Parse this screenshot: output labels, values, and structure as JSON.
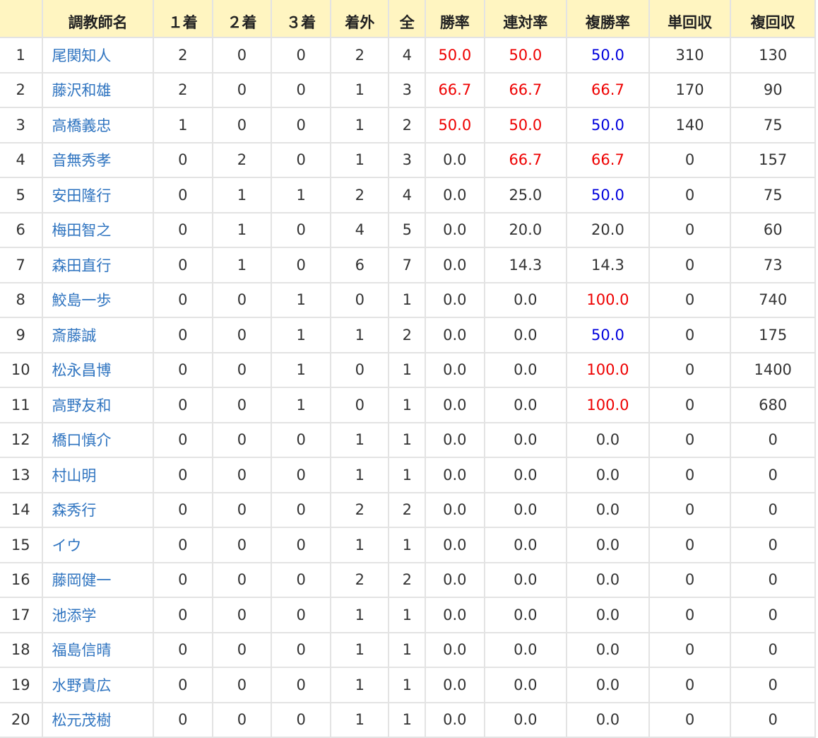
{
  "colors": {
    "header_bg": "#fff5c1",
    "link": "#2f74c0",
    "high": "#ee0000",
    "mid": "#0000dd",
    "text": "#333333",
    "border": "#e3e3e3"
  },
  "headers": [
    "",
    "調教師名",
    "１着",
    "２着",
    "３着",
    "着外",
    "全",
    "勝率",
    "連対率",
    "複勝率",
    "単回収",
    "複回収"
  ],
  "rows": [
    {
      "rank": "1",
      "name": "尾関知人",
      "first": "2",
      "second": "0",
      "third": "0",
      "out": "2",
      "total": "4",
      "win_rate": "50.0",
      "win_color": "red",
      "quinella_rate": "50.0",
      "quinella_color": "red",
      "place_rate": "50.0",
      "place_color": "blue",
      "win_return": "310",
      "place_return": "130"
    },
    {
      "rank": "2",
      "name": "藤沢和雄",
      "first": "2",
      "second": "0",
      "third": "0",
      "out": "1",
      "total": "3",
      "win_rate": "66.7",
      "win_color": "red",
      "quinella_rate": "66.7",
      "quinella_color": "red",
      "place_rate": "66.7",
      "place_color": "red",
      "win_return": "170",
      "place_return": "90"
    },
    {
      "rank": "3",
      "name": "高橋義忠",
      "first": "1",
      "second": "0",
      "third": "0",
      "out": "1",
      "total": "2",
      "win_rate": "50.0",
      "win_color": "red",
      "quinella_rate": "50.0",
      "quinella_color": "red",
      "place_rate": "50.0",
      "place_color": "blue",
      "win_return": "140",
      "place_return": "75"
    },
    {
      "rank": "4",
      "name": "音無秀孝",
      "first": "0",
      "second": "2",
      "third": "0",
      "out": "1",
      "total": "3",
      "win_rate": "0.0",
      "win_color": "",
      "quinella_rate": "66.7",
      "quinella_color": "red",
      "place_rate": "66.7",
      "place_color": "red",
      "win_return": "0",
      "place_return": "157"
    },
    {
      "rank": "5",
      "name": "安田隆行",
      "first": "0",
      "second": "1",
      "third": "1",
      "out": "2",
      "total": "4",
      "win_rate": "0.0",
      "win_color": "",
      "quinella_rate": "25.0",
      "quinella_color": "",
      "place_rate": "50.0",
      "place_color": "blue",
      "win_return": "0",
      "place_return": "75"
    },
    {
      "rank": "6",
      "name": "梅田智之",
      "first": "0",
      "second": "1",
      "third": "0",
      "out": "4",
      "total": "5",
      "win_rate": "0.0",
      "win_color": "",
      "quinella_rate": "20.0",
      "quinella_color": "",
      "place_rate": "20.0",
      "place_color": "",
      "win_return": "0",
      "place_return": "60"
    },
    {
      "rank": "7",
      "name": "森田直行",
      "first": "0",
      "second": "1",
      "third": "0",
      "out": "6",
      "total": "7",
      "win_rate": "0.0",
      "win_color": "",
      "quinella_rate": "14.3",
      "quinella_color": "",
      "place_rate": "14.3",
      "place_color": "",
      "win_return": "0",
      "place_return": "73"
    },
    {
      "rank": "8",
      "name": "鮫島一歩",
      "first": "0",
      "second": "0",
      "third": "1",
      "out": "0",
      "total": "1",
      "win_rate": "0.0",
      "win_color": "",
      "quinella_rate": "0.0",
      "quinella_color": "",
      "place_rate": "100.0",
      "place_color": "red",
      "win_return": "0",
      "place_return": "740"
    },
    {
      "rank": "9",
      "name": "斎藤誠",
      "first": "0",
      "second": "0",
      "third": "1",
      "out": "1",
      "total": "2",
      "win_rate": "0.0",
      "win_color": "",
      "quinella_rate": "0.0",
      "quinella_color": "",
      "place_rate": "50.0",
      "place_color": "blue",
      "win_return": "0",
      "place_return": "175"
    },
    {
      "rank": "10",
      "name": "松永昌博",
      "first": "0",
      "second": "0",
      "third": "1",
      "out": "0",
      "total": "1",
      "win_rate": "0.0",
      "win_color": "",
      "quinella_rate": "0.0",
      "quinella_color": "",
      "place_rate": "100.0",
      "place_color": "red",
      "win_return": "0",
      "place_return": "1400"
    },
    {
      "rank": "11",
      "name": "高野友和",
      "first": "0",
      "second": "0",
      "third": "1",
      "out": "0",
      "total": "1",
      "win_rate": "0.0",
      "win_color": "",
      "quinella_rate": "0.0",
      "quinella_color": "",
      "place_rate": "100.0",
      "place_color": "red",
      "win_return": "0",
      "place_return": "680"
    },
    {
      "rank": "12",
      "name": "橋口慎介",
      "first": "0",
      "second": "0",
      "third": "0",
      "out": "1",
      "total": "1",
      "win_rate": "0.0",
      "win_color": "",
      "quinella_rate": "0.0",
      "quinella_color": "",
      "place_rate": "0.0",
      "place_color": "",
      "win_return": "0",
      "place_return": "0"
    },
    {
      "rank": "13",
      "name": "村山明",
      "first": "0",
      "second": "0",
      "third": "0",
      "out": "1",
      "total": "1",
      "win_rate": "0.0",
      "win_color": "",
      "quinella_rate": "0.0",
      "quinella_color": "",
      "place_rate": "0.0",
      "place_color": "",
      "win_return": "0",
      "place_return": "0"
    },
    {
      "rank": "14",
      "name": "森秀行",
      "first": "0",
      "second": "0",
      "third": "0",
      "out": "2",
      "total": "2",
      "win_rate": "0.0",
      "win_color": "",
      "quinella_rate": "0.0",
      "quinella_color": "",
      "place_rate": "0.0",
      "place_color": "",
      "win_return": "0",
      "place_return": "0"
    },
    {
      "rank": "15",
      "name": "イウ",
      "first": "0",
      "second": "0",
      "third": "0",
      "out": "1",
      "total": "1",
      "win_rate": "0.0",
      "win_color": "",
      "quinella_rate": "0.0",
      "quinella_color": "",
      "place_rate": "0.0",
      "place_color": "",
      "win_return": "0",
      "place_return": "0"
    },
    {
      "rank": "16",
      "name": "藤岡健一",
      "first": "0",
      "second": "0",
      "third": "0",
      "out": "2",
      "total": "2",
      "win_rate": "0.0",
      "win_color": "",
      "quinella_rate": "0.0",
      "quinella_color": "",
      "place_rate": "0.0",
      "place_color": "",
      "win_return": "0",
      "place_return": "0"
    },
    {
      "rank": "17",
      "name": "池添学",
      "first": "0",
      "second": "0",
      "third": "0",
      "out": "1",
      "total": "1",
      "win_rate": "0.0",
      "win_color": "",
      "quinella_rate": "0.0",
      "quinella_color": "",
      "place_rate": "0.0",
      "place_color": "",
      "win_return": "0",
      "place_return": "0"
    },
    {
      "rank": "18",
      "name": "福島信晴",
      "first": "0",
      "second": "0",
      "third": "0",
      "out": "1",
      "total": "1",
      "win_rate": "0.0",
      "win_color": "",
      "quinella_rate": "0.0",
      "quinella_color": "",
      "place_rate": "0.0",
      "place_color": "",
      "win_return": "0",
      "place_return": "0"
    },
    {
      "rank": "19",
      "name": "水野貴広",
      "first": "0",
      "second": "0",
      "third": "0",
      "out": "1",
      "total": "1",
      "win_rate": "0.0",
      "win_color": "",
      "quinella_rate": "0.0",
      "quinella_color": "",
      "place_rate": "0.0",
      "place_color": "",
      "win_return": "0",
      "place_return": "0"
    },
    {
      "rank": "20",
      "name": "松元茂樹",
      "first": "0",
      "second": "0",
      "third": "0",
      "out": "1",
      "total": "1",
      "win_rate": "0.0",
      "win_color": "",
      "quinella_rate": "0.0",
      "quinella_color": "",
      "place_rate": "0.0",
      "place_color": "",
      "win_return": "0",
      "place_return": "0"
    }
  ]
}
